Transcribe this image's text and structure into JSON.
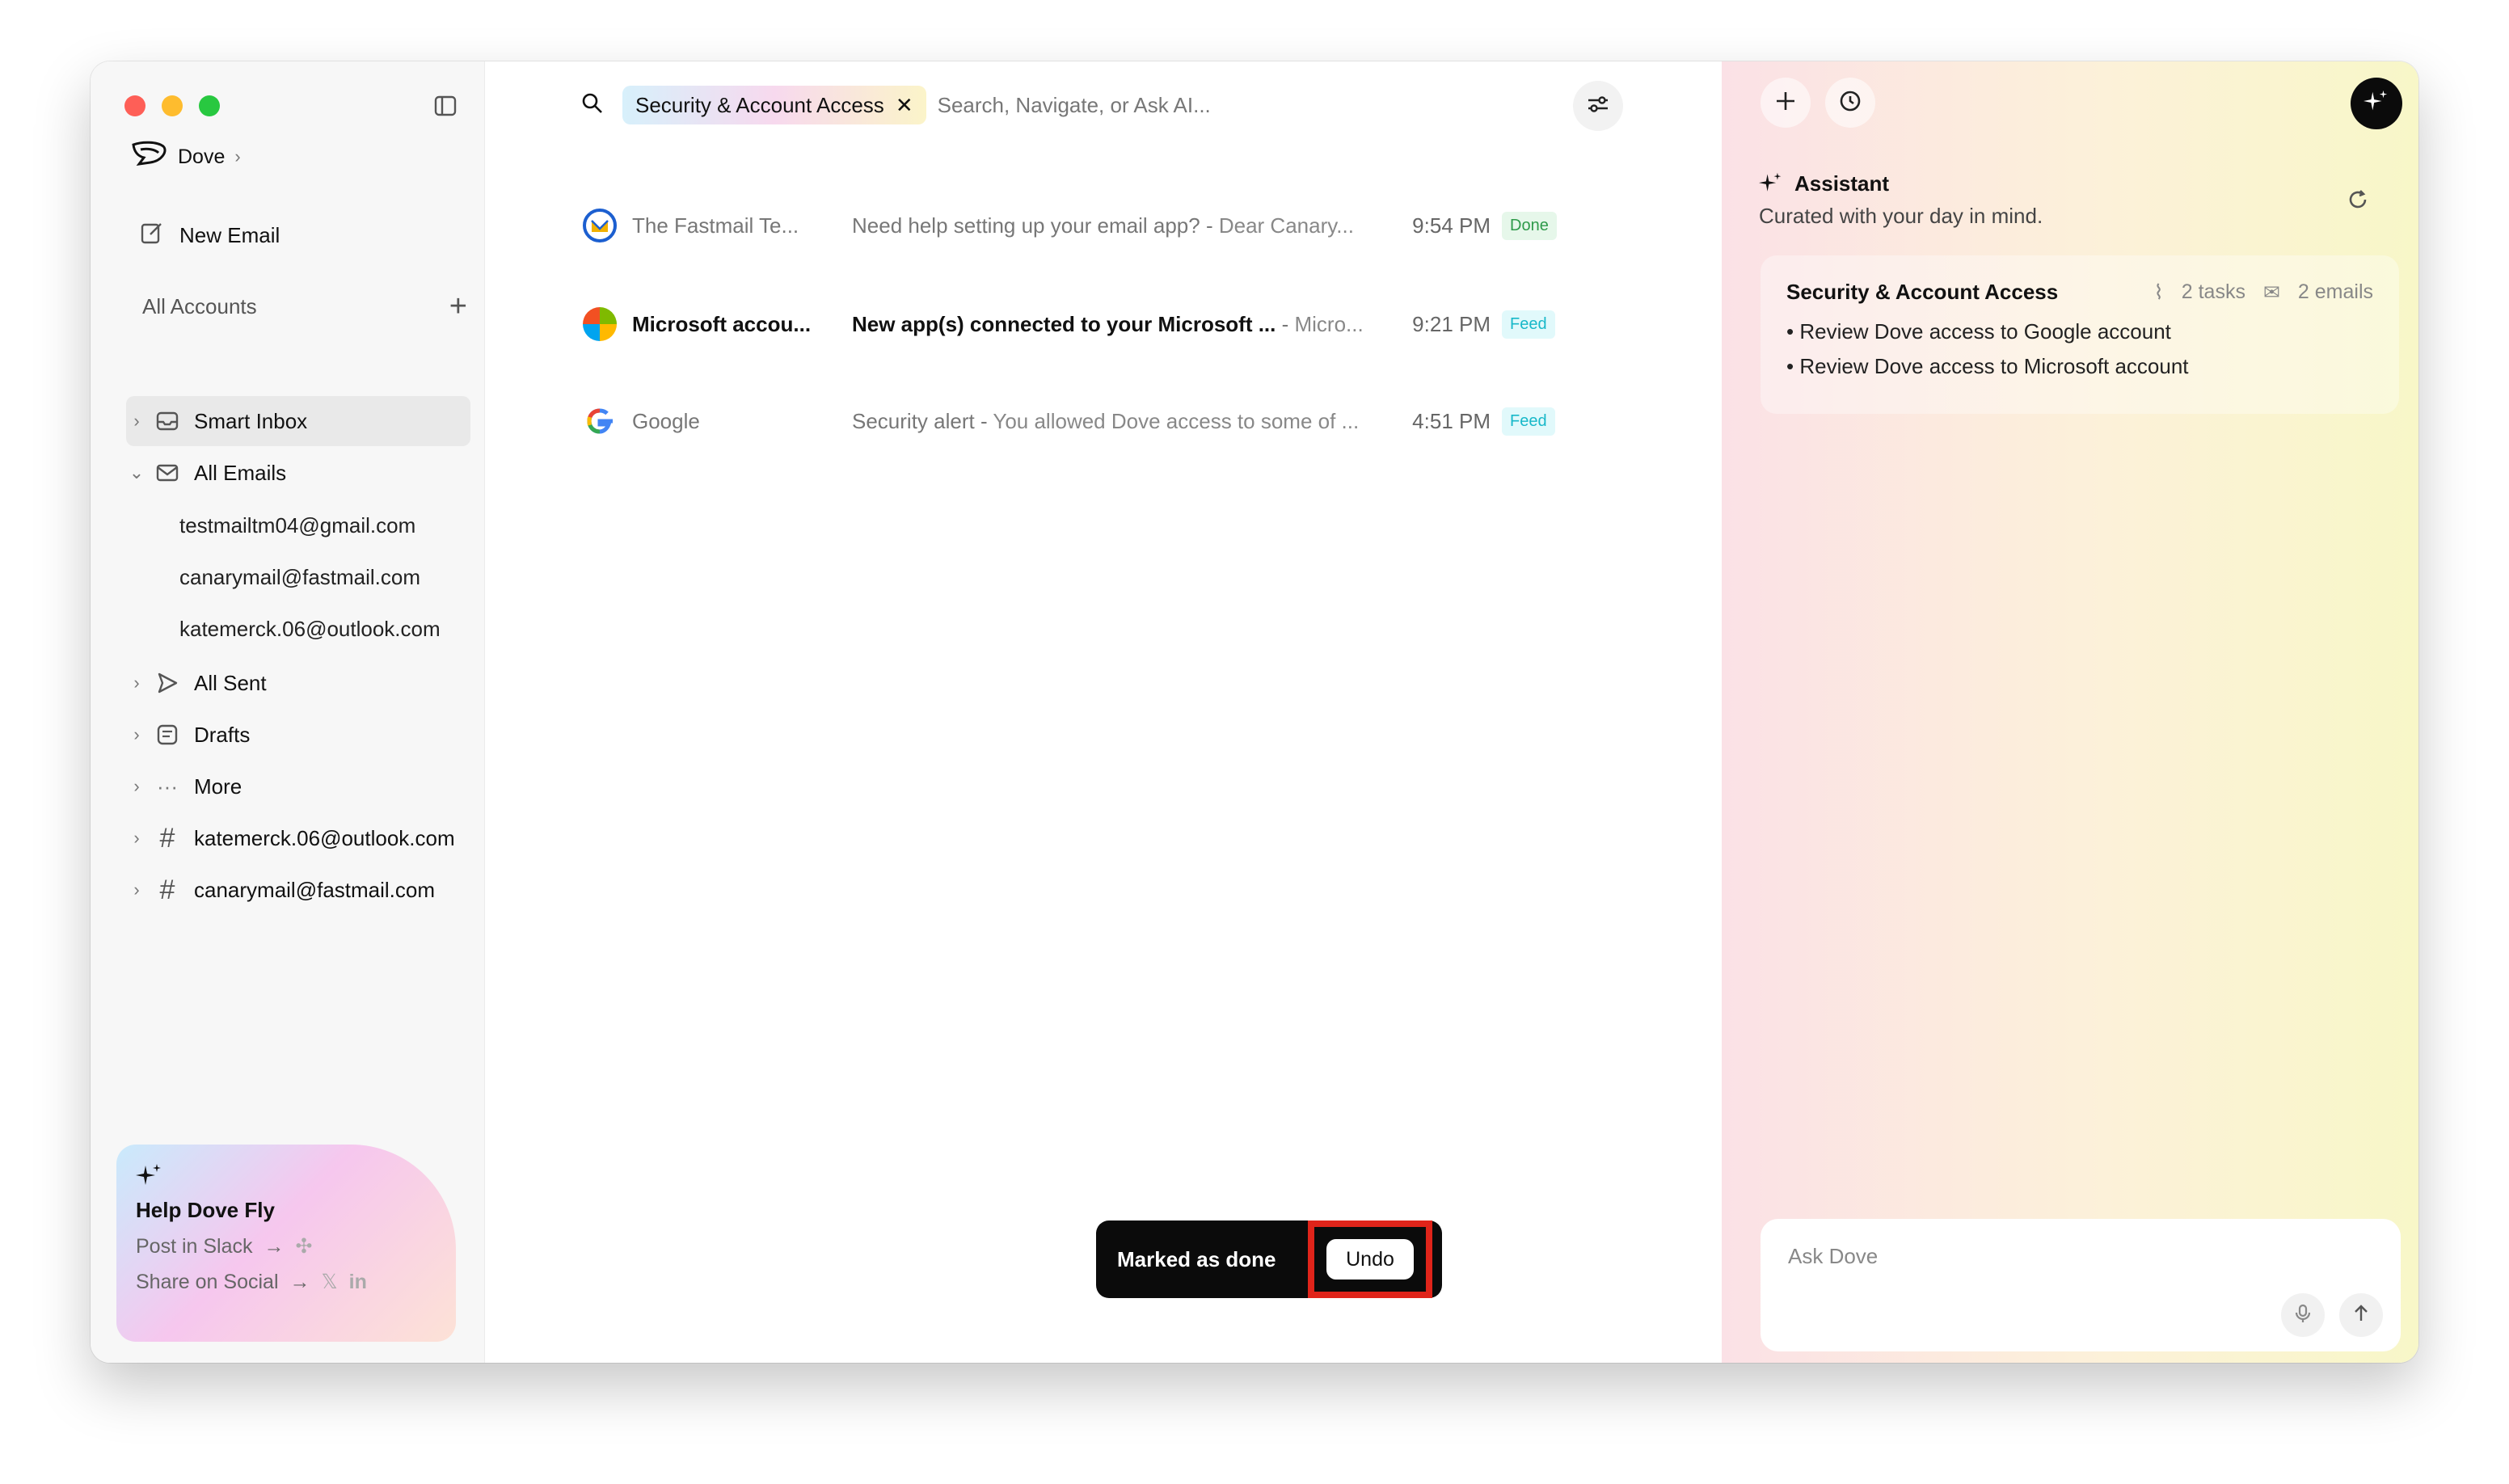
{
  "colors": {
    "accent_red": "#e0241a",
    "done_green": "#2e9a4a",
    "feed_cyan": "#18b8c9"
  },
  "sidebar": {
    "brand": "Dove",
    "new_email": "New Email",
    "accounts_title": "All Accounts",
    "items": [
      {
        "label": "Smart Inbox",
        "icon": "inbox-icon"
      },
      {
        "label": "All Emails",
        "icon": "mail-icon"
      },
      {
        "label": "All Sent",
        "icon": "send-icon"
      },
      {
        "label": "Drafts",
        "icon": "draft-icon"
      },
      {
        "label": "More",
        "icon": "more-icon"
      },
      {
        "label": "katemerck.06@outlook.com",
        "icon": "hash-icon"
      },
      {
        "label": "canarymail@fastmail.com",
        "icon": "hash-icon"
      }
    ],
    "sub_accounts": [
      "testmailtm04@gmail.com",
      "canarymail@fastmail.com",
      "katemerck.06@outlook.com"
    ],
    "help_card": {
      "title": "Help Dove Fly",
      "post_label": "Post in Slack",
      "share_label": "Share on Social"
    }
  },
  "search": {
    "chip": "Security & Account Access",
    "placeholder": "Search, Navigate, or Ask AI..."
  },
  "emails": [
    {
      "sender": "The Fastmail Te...",
      "subject": "Need help setting up your email app?",
      "preview": "Dear Canary...",
      "time": "9:54 PM",
      "badge": "Done",
      "logo": "fastmail-logo-icon"
    },
    {
      "sender": "Microsoft accou...",
      "subject": "New app(s) connected to your Microsoft ...",
      "preview": "Micro...",
      "time": "9:21 PM",
      "badge": "Feed",
      "logo": "microsoft-logo-icon"
    },
    {
      "sender": "Google",
      "subject": "Security alert",
      "preview": "You allowed Dove access to some of ...",
      "time": "4:51 PM",
      "badge": "Feed",
      "logo": "google-logo-icon"
    }
  ],
  "toast": {
    "message": "Marked as done",
    "undo": "Undo"
  },
  "assistant": {
    "title": "Assistant",
    "subtitle": "Curated with your day in mind.",
    "card": {
      "title": "Security & Account Access",
      "tasks": "2 tasks",
      "emails": "2 emails",
      "items": [
        "• Review Dove access to Google account",
        "• Review Dove access to Microsoft account"
      ]
    },
    "ask_placeholder": "Ask Dove"
  }
}
